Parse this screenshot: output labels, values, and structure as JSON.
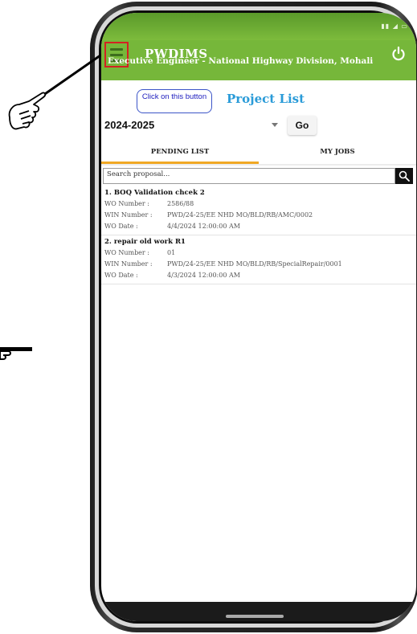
{
  "app": {
    "title": "PWDIMS",
    "subtitle": "Executive Engineer - National Highway Division, Mohali",
    "menu_icon": "hamburger-menu-icon",
    "power_icon": "power-icon"
  },
  "annotation": {
    "tooltip": "Click on this button",
    "hand_icon": "pointing-hand-icon"
  },
  "page": {
    "title": "Project List"
  },
  "filter": {
    "year": "2024-2025",
    "go_label": "Go"
  },
  "tabs": [
    {
      "label": "PENDING LIST",
      "active": true
    },
    {
      "label": "MY JOBS",
      "active": false
    }
  ],
  "search": {
    "placeholder": "Search proposal..."
  },
  "projects": [
    {
      "title": "1. BOQ Validation chcek 2",
      "wo_number_label": "WO Number :",
      "wo_number": "2586/88",
      "win_number_label": "WIN Number :",
      "win_number": "PWD/24-25/EE NHD MO/BLD/RB/AMC/0002",
      "wo_date_label": "WO Date :",
      "wo_date": "4/4/2024 12:00:00 AM"
    },
    {
      "title": "2. repair old work R1",
      "wo_number_label": "WO Number :",
      "wo_number": "01",
      "win_number_label": "WIN Number :",
      "win_number": "PWD/24-25/EE NHD MO/BLD/RB/SpecialRepair/0001",
      "wo_date_label": "WO Date :",
      "wo_date": "4/3/2024 12:00:00 AM"
    }
  ],
  "colors": {
    "appbar": "#76b73a",
    "title_blue": "#2a9bd8",
    "tab_underline": "#f0a824",
    "highlight_red": "#d32222"
  }
}
